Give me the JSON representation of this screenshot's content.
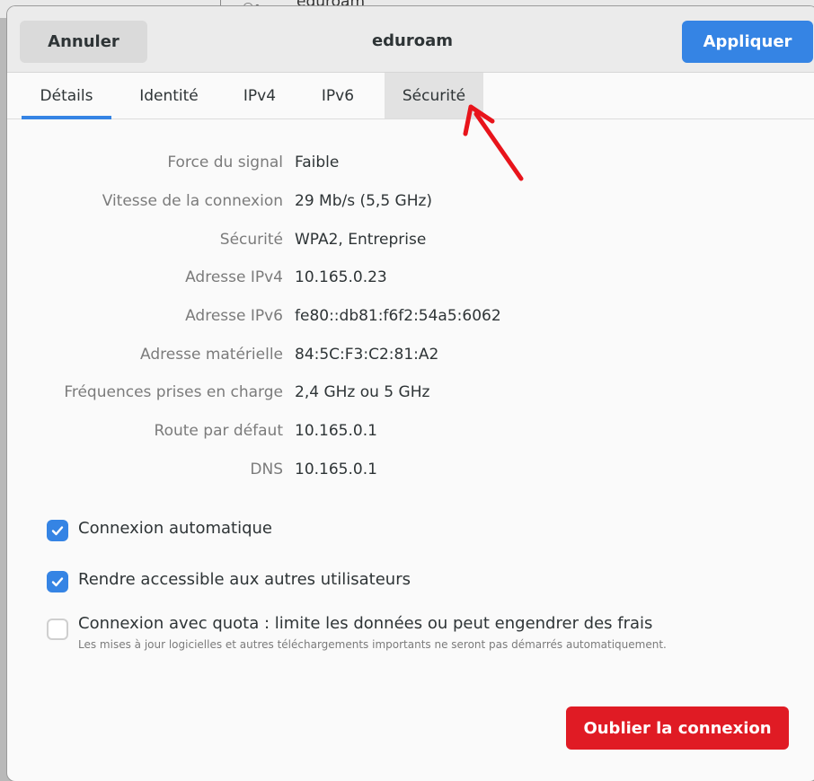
{
  "background": {
    "network_name": "eduroam",
    "wifi_icon": "wifi-icon"
  },
  "headerbar": {
    "cancel_label": "Annuler",
    "title": "eduroam",
    "apply_label": "Appliquer"
  },
  "tabs": [
    {
      "label": "Détails",
      "active": true
    },
    {
      "label": "Identité",
      "active": false
    },
    {
      "label": "IPv4",
      "active": false
    },
    {
      "label": "IPv6",
      "active": false
    },
    {
      "label": "Sécurité",
      "active": false,
      "hover": true
    }
  ],
  "details": [
    {
      "label": "Force du signal",
      "value": "Faible"
    },
    {
      "label": "Vitesse de la connexion",
      "value": "29 Mb/s (5,5 GHz)"
    },
    {
      "label": "Sécurité",
      "value": "WPA2, Entreprise"
    },
    {
      "label": "Adresse IPv4",
      "value": "10.165.0.23"
    },
    {
      "label": "Adresse IPv6",
      "value": "fe80::db81:f6f2:54a5:6062"
    },
    {
      "label": "Adresse matérielle",
      "value": "84:5C:F3:C2:81:A2"
    },
    {
      "label": "Fréquences prises en charge",
      "value": "2,4 GHz ou 5 GHz"
    },
    {
      "label": "Route par défaut",
      "value": "10.165.0.1"
    },
    {
      "label": "DNS",
      "value": "10.165.0.1"
    }
  ],
  "options": {
    "auto_connect": {
      "label": "Connexion automatique",
      "checked": true
    },
    "all_users": {
      "label": "Rendre accessible aux autres utilisateurs",
      "checked": true
    },
    "metered": {
      "label": "Connexion avec quota : limite les données ou peut engendrer des frais",
      "description": "Les mises à jour logicielles et autres téléchargements importants ne seront pas démarrés automatiquement.",
      "checked": false
    }
  },
  "forget_label": "Oublier la connexion",
  "colors": {
    "accent": "#3584e4",
    "destructive": "#e01b24",
    "annotation_arrow": "#e8141b"
  }
}
